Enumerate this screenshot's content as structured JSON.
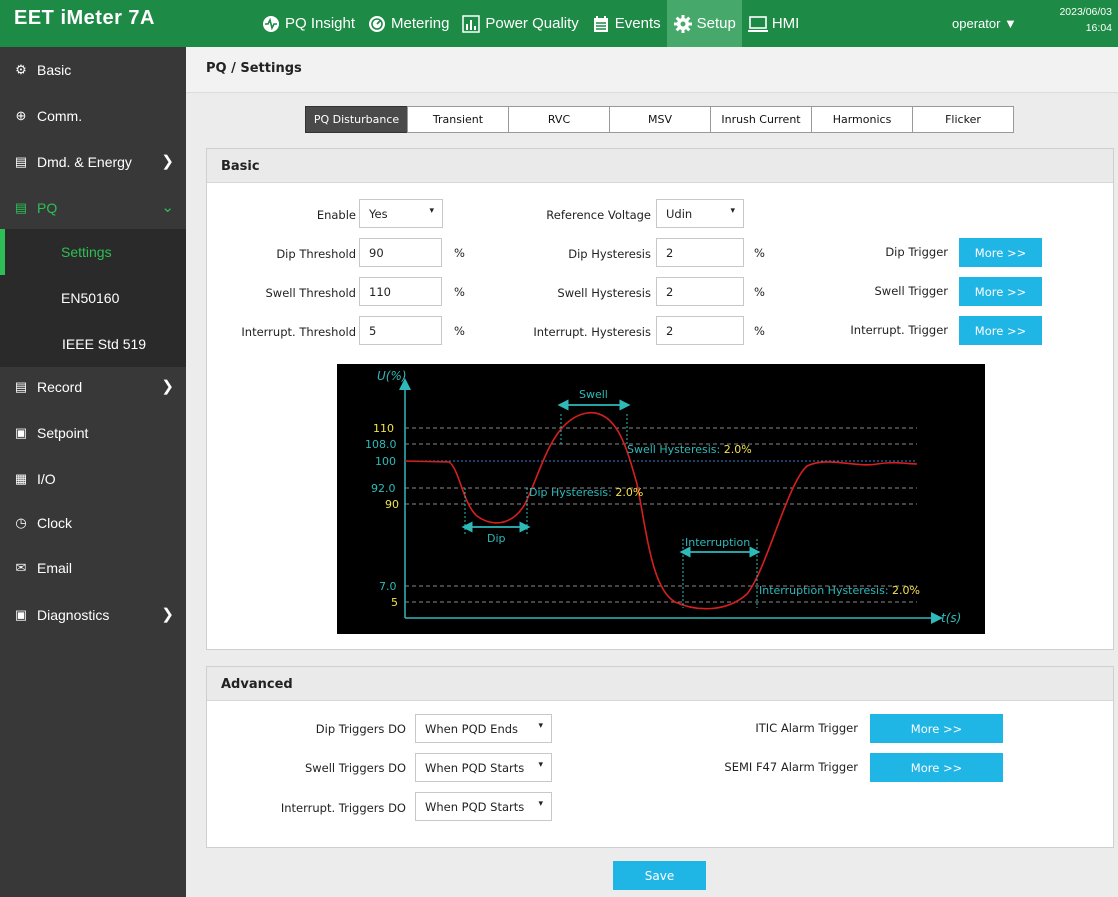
{
  "topbar": {
    "brand": "EET iMeter 7A",
    "nav": [
      {
        "label": "PQ Insight",
        "icon": "pq-insight-icon"
      },
      {
        "label": "Metering",
        "icon": "metering-icon"
      },
      {
        "label": "Power Quality",
        "icon": "power-quality-icon"
      },
      {
        "label": "Events",
        "icon": "events-icon"
      },
      {
        "label": "Setup",
        "icon": "gear-icon"
      },
      {
        "label": "HMI",
        "icon": "hmi-icon"
      }
    ],
    "user": "operator ▼",
    "date": "2023/06/03",
    "time": "16:04"
  },
  "sidebar": {
    "items": [
      {
        "label": "Basic"
      },
      {
        "label": "Comm."
      },
      {
        "label": "Dmd. & Energy"
      },
      {
        "label": "PQ"
      },
      {
        "label": "Record"
      },
      {
        "label": "Setpoint"
      },
      {
        "label": "I/O"
      },
      {
        "label": "Clock"
      },
      {
        "label": "Email"
      },
      {
        "label": "Diagnostics"
      }
    ],
    "sub": [
      {
        "label": "Settings"
      },
      {
        "label": "EN50160"
      },
      {
        "label": "IEEE Std 519"
      }
    ]
  },
  "page": {
    "title": "PQ / Settings",
    "tabs": [
      "PQ Disturbance",
      "Transient",
      "RVC",
      "MSV",
      "Inrush Current",
      "Harmonics",
      "Flicker"
    ]
  },
  "basic": {
    "title": "Basic",
    "enable_label": "Enable",
    "enable_value": "Yes",
    "ref_voltage_label": "Reference Voltage",
    "ref_voltage_value": "Udin",
    "dip_threshold_label": "Dip Threshold",
    "dip_threshold_value": "90",
    "swell_threshold_label": "Swell Threshold",
    "swell_threshold_value": "110",
    "interrupt_threshold_label": "Interrupt. Threshold",
    "interrupt_threshold_value": "5",
    "dip_hysteresis_label": "Dip Hysteresis",
    "dip_hysteresis_value": "2",
    "swell_hysteresis_label": "Swell Hysteresis",
    "swell_hysteresis_value": "2",
    "interrupt_hysteresis_label": "Interrupt. Hysteresis",
    "interrupt_hysteresis_value": "2",
    "unit": "%",
    "dip_trigger_label": "Dip Trigger",
    "swell_trigger_label": "Swell Trigger",
    "interrupt_trigger_label": "Interrupt. Trigger",
    "more_label": "More >>"
  },
  "diagram": {
    "y_axis": "U(%)",
    "x_axis": "t(s)",
    "levels": [
      "110",
      "108.0",
      "100",
      "92.0",
      "90",
      "7.0",
      "5"
    ],
    "swell": "Swell",
    "dip": "Dip",
    "interruption": "Interruption",
    "swell_hyst_text": "Swell Hysteresis: ",
    "dip_hyst_text": "Dip Hysteresis: ",
    "int_hyst_text": "Interruption Hysteresis: ",
    "hyst_value": "2.0%",
    "colors": {
      "cyan": "#2fb9b9",
      "yellow": "#f2e24a",
      "curve": "#d62020",
      "ref": "#3a7fd0"
    }
  },
  "advanced": {
    "title": "Advanced",
    "dip_do_label": "Dip Triggers DO",
    "dip_do_value": "When PQD Ends",
    "swell_do_label": "Swell Triggers DO",
    "swell_do_value": "When PQD Starts",
    "int_do_label": "Interrupt. Triggers DO",
    "int_do_value": "When PQD Starts",
    "itic_label": "ITIC Alarm Trigger",
    "semi_label": "SEMI F47 Alarm Trigger",
    "more_label": "More >>"
  },
  "save_label": "Save",
  "colors": {
    "topbar": "#1d8a45",
    "sidebar": "#383838",
    "accent_green": "#2dbf55",
    "button_blue": "#1fb6e6"
  }
}
